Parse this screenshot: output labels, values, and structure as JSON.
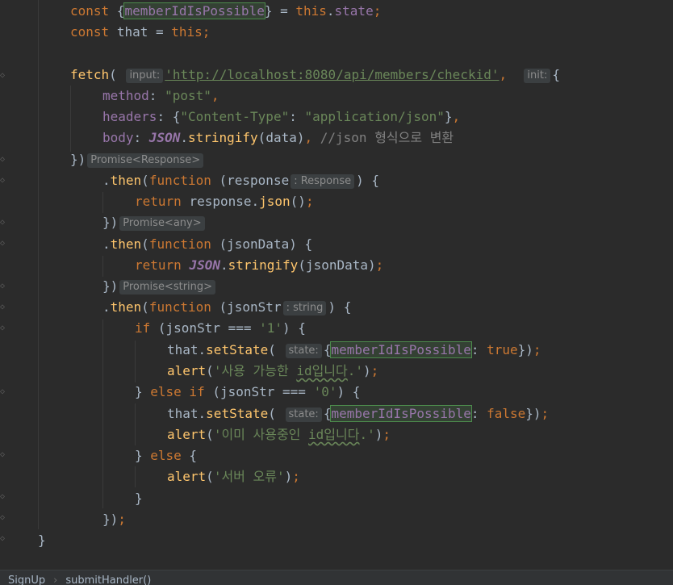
{
  "code": {
    "l1_const": "const",
    "l1_var": "memberIdIsPossible",
    "l1_this": "this",
    "l1_state": "state",
    "l2_const": "const",
    "l2_that": "that",
    "l2_this": "this",
    "l3_fetch": "fetch",
    "l3_hint": "input:",
    "l3_url": "'http://localhost:8080/api/members/checkid'",
    "l3_hint2": "init:",
    "l4_key": "method",
    "l4_val": "\"post\"",
    "l5_key": "headers",
    "l5_k": "\"Content-Type\"",
    "l5_v": "\"application/json\"",
    "l6_key": "body",
    "l6_obj": "JSON",
    "l6_fn": "stringify",
    "l6_arg": "data",
    "l6_cmt": "//json 형식으로 변환",
    "l7_hint": "Promise<Response>",
    "l8_then": "then",
    "l8_function": "function",
    "l8_param": "response",
    "l8_hint": ": Response",
    "l9_return": "return",
    "l9_call": "response.",
    "l9_fn": "json",
    "l10_hint": "Promise<any>",
    "l11_then": "then",
    "l11_function": "function",
    "l11_param": "jsonData",
    "l12_return": "return",
    "l12_obj": "JSON",
    "l12_fn": "stringify",
    "l12_arg": "jsonData",
    "l13_hint": "Promise<string>",
    "l14_then": "then",
    "l14_function": "function",
    "l14_param": "jsonStr",
    "l14_hint": ": string",
    "l15_if": "if",
    "l15_cond": "jsonStr === ",
    "l15_str": "'1'",
    "l16_that": "that.",
    "l16_fn": "setState",
    "l16_hint": "state:",
    "l16_key": "memberIdIsPossible",
    "l16_val": "true",
    "l17_alert": "alert",
    "l17_str1": "'사용 가능한 ",
    "l17_sq": "id입니다",
    "l17_str2": ".'",
    "l18_else": "else if",
    "l18_cond": "jsonStr === ",
    "l18_str": "'0'",
    "l19_that": "that.",
    "l19_fn": "setState",
    "l19_hint": "state:",
    "l19_key": "memberIdIsPossible",
    "l19_val": "false",
    "l20_alert": "alert",
    "l20_str1": "'이미 사용중인 ",
    "l20_sq": "id입니다",
    "l20_str2": ".'",
    "l21_else": "else",
    "l22_alert": "alert",
    "l22_str": "'서버 오류'"
  },
  "breadcrumb": {
    "item1": "SignUp",
    "item2": "submitHandler()"
  }
}
